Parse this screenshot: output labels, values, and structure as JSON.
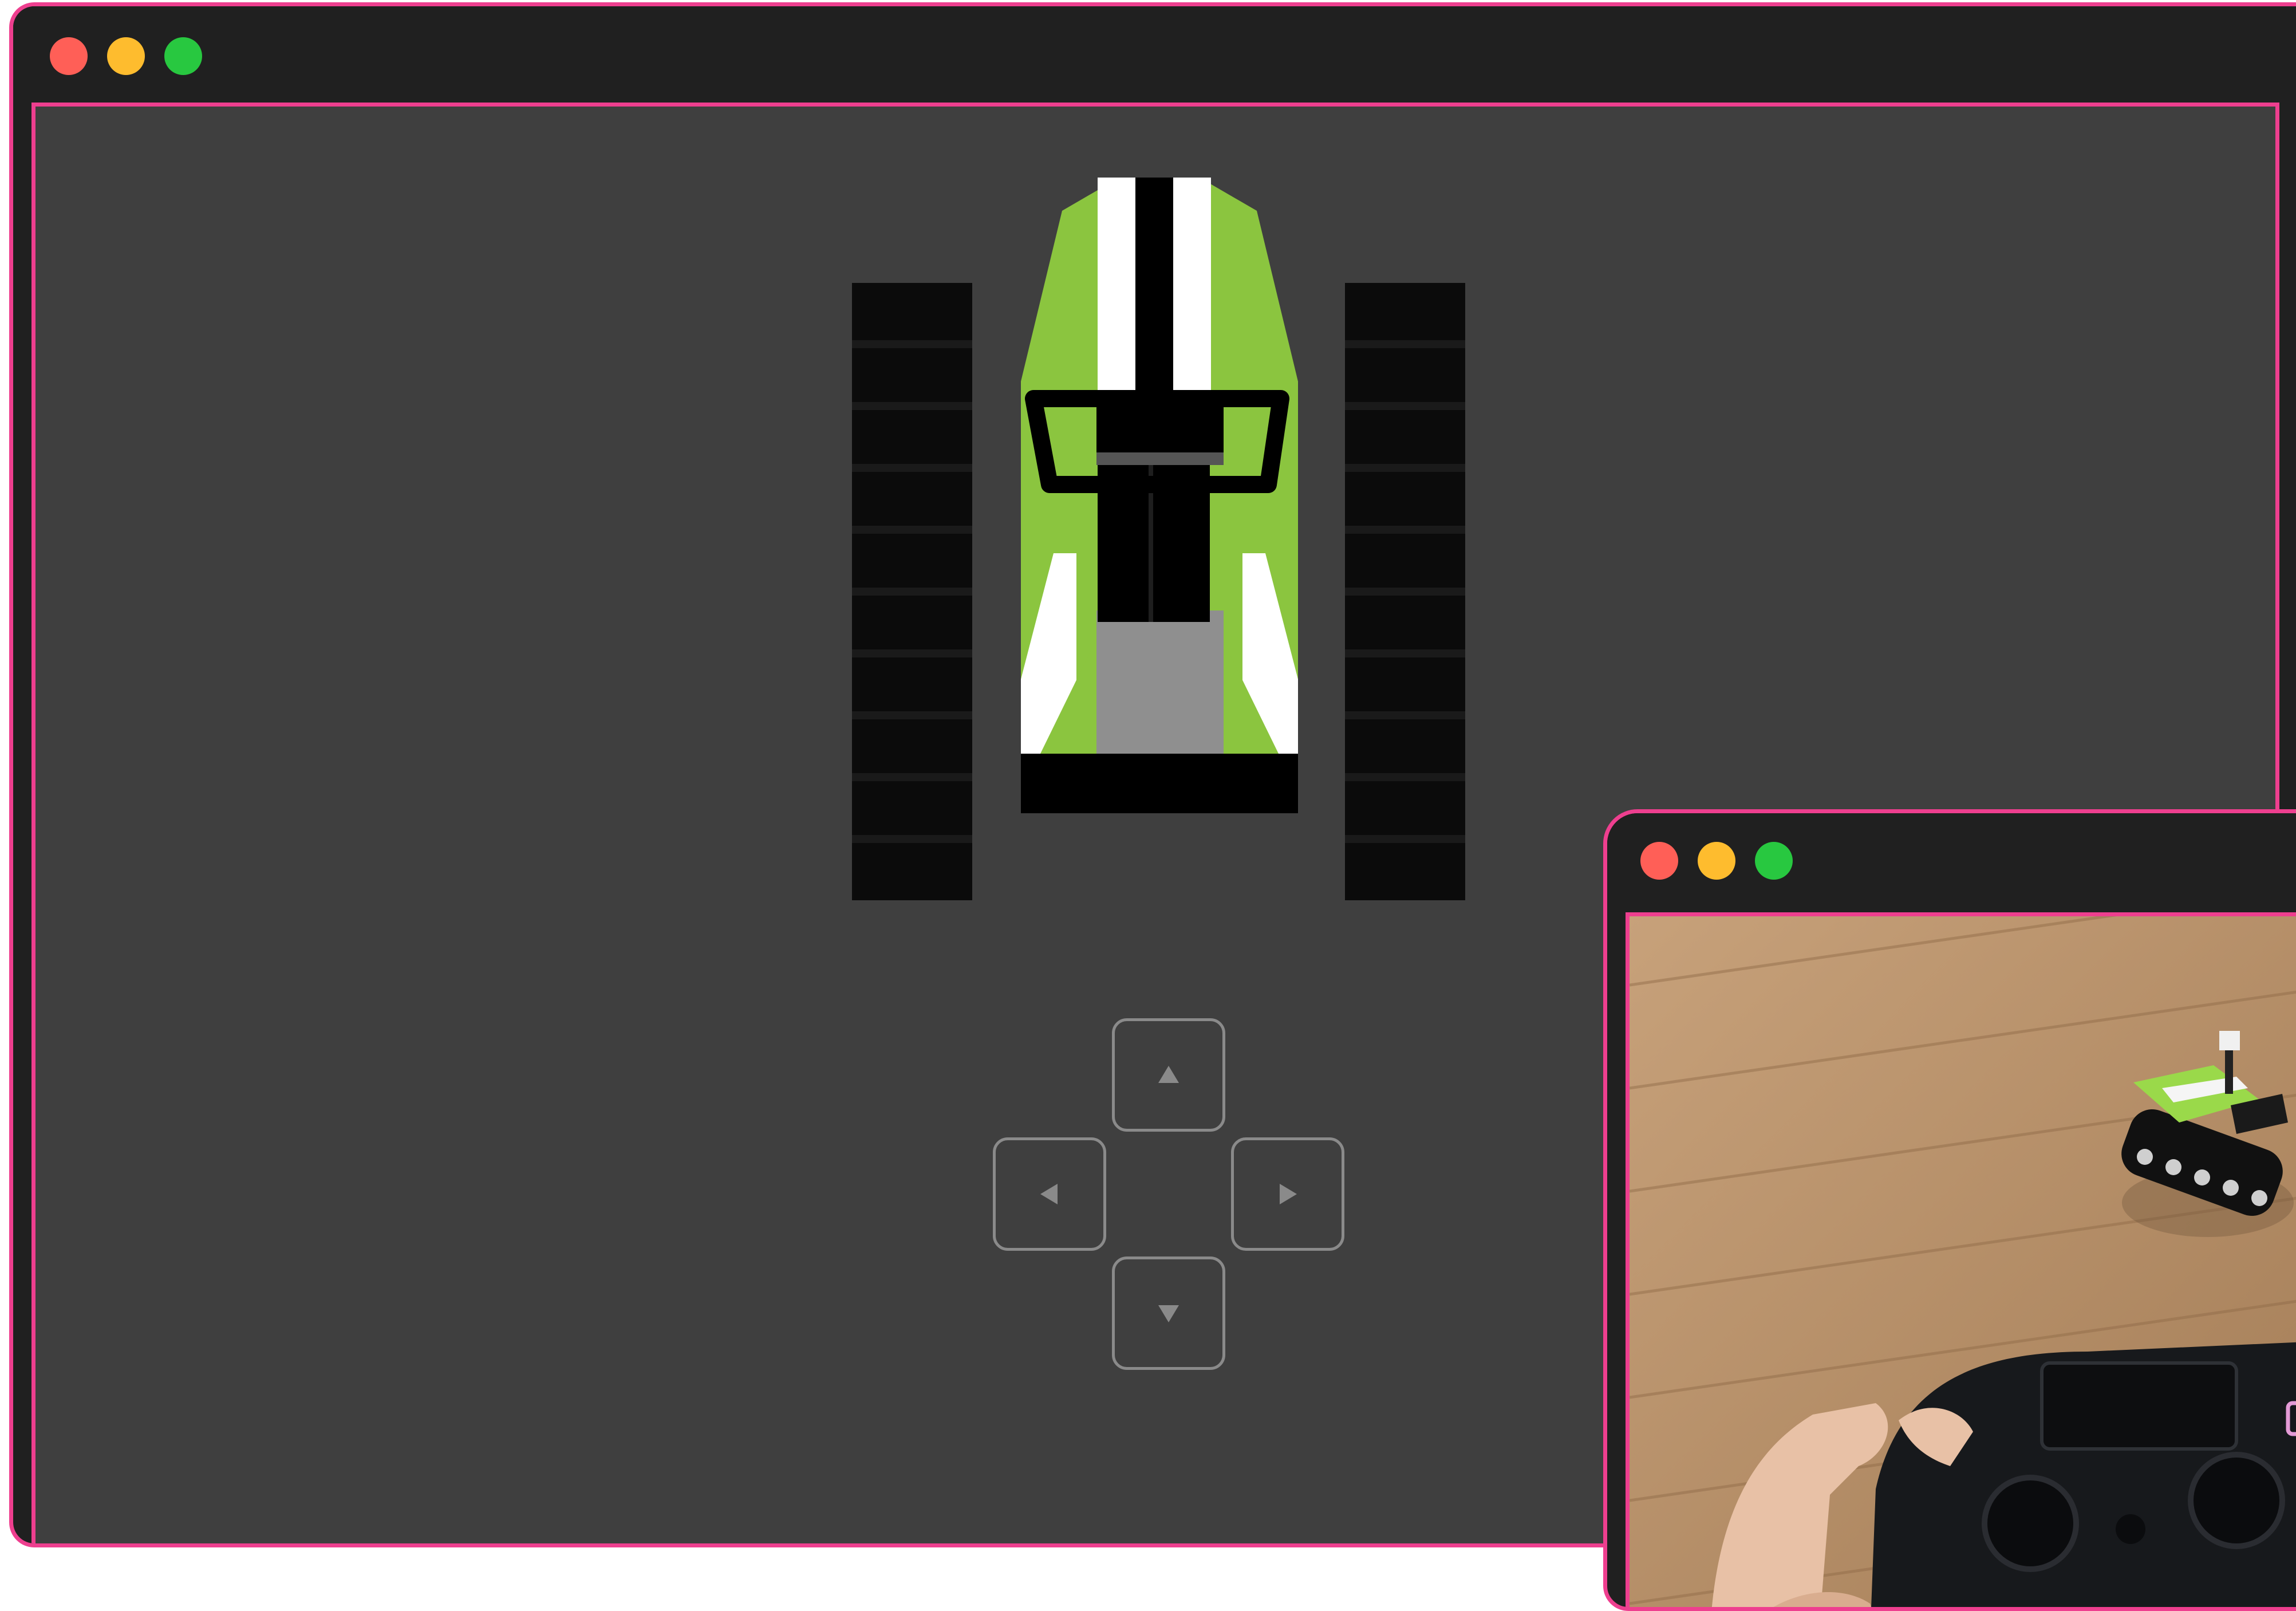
{
  "main_window": {
    "traffic_lights": [
      {
        "name": "close",
        "color": "#ff5f57"
      },
      {
        "name": "minimize",
        "color": "#febc2e"
      },
      {
        "name": "zoom",
        "color": "#28c840"
      }
    ]
  },
  "robot": {
    "body_color": "#8bc53f",
    "stripe_color": "#ffffff",
    "frame_color": "#000000",
    "deck_color": "#8f8f8f",
    "track_color": "#0b0b0b"
  },
  "dpad": {
    "up_icon": "arrow-up-icon",
    "left_icon": "arrow-left-icon",
    "right_icon": "arrow-right-icon",
    "down_icon": "arrow-down-icon"
  },
  "camera_window": {
    "traffic_lights": [
      {
        "name": "close",
        "color": "#ff5f57"
      },
      {
        "name": "minimize",
        "color": "#febc2e"
      },
      {
        "name": "zoom",
        "color": "#28c840"
      }
    ],
    "feed_description_icon": "camera-feed"
  },
  "accent_color": "#ee3f8f"
}
